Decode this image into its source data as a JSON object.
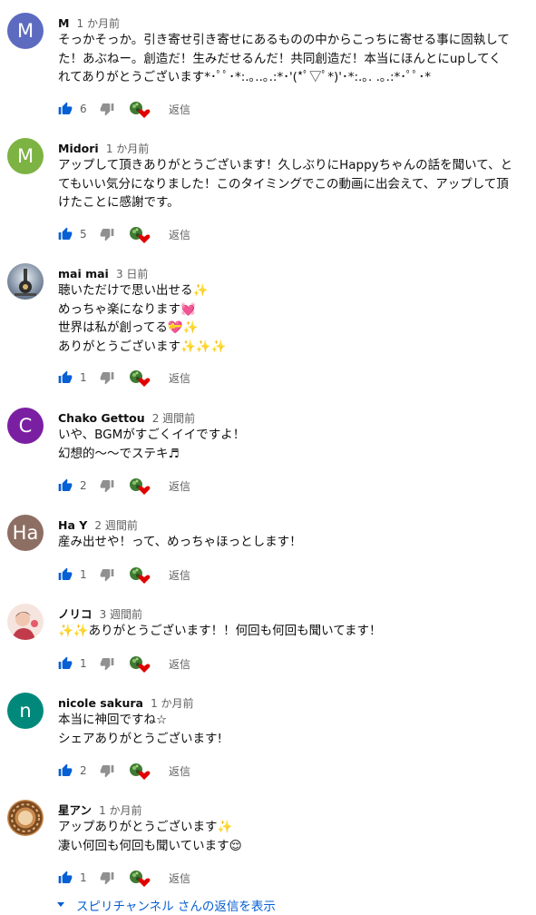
{
  "colors": {
    "link": "#065fd4",
    "like_blue": "#065fd4",
    "muted": "#606060",
    "heart_red": "#e00000"
  },
  "comments": [
    {
      "author": "M",
      "time": "1 か月前",
      "avatar_letter": "M",
      "avatar_color": "#5c6bc0",
      "lines": [
        "そっかそっか。引き寄せ引き寄せにあるものの中からこっちに寄せる事に固執して",
        "た！あぶねー。創造だ！生みだせるんだ！共同創造だ！本当にほんとにupしてく",
        "れてありがとうございます*･ﾟﾟ･*:.｡..｡.:*･'(*ﾟ▽ﾟ*)'･*:.｡. .｡.:*･ﾟﾟ･*"
      ],
      "likes": "6",
      "reply": "返信"
    },
    {
      "author": "Midori",
      "time": "1 か月前",
      "avatar_letter": "M",
      "avatar_color": "#7cb342",
      "lines": [
        "アップして頂きありがとうございます！久しぶりにHappyちゃんの話を聞いて、と",
        "てもいい気分になりました！このタイミングでこの動画に出会えて、アップして頂",
        "けたことに感謝です。"
      ],
      "likes": "5",
      "reply": "返信"
    },
    {
      "author": "mai mai",
      "time": "3 日前",
      "avatar_icon": "telescope-photo",
      "lines": [
        "聴いただけで思い出せる✨",
        "めっちゃ楽になります💓",
        "世界は私が創ってる💝✨",
        "ありがとうございます✨✨✨"
      ],
      "likes": "1",
      "reply": "返信"
    },
    {
      "author": "Chako Gettou",
      "time": "2 週間前",
      "avatar_letter": "C",
      "avatar_color": "#7b1fa2",
      "lines": [
        "いや、BGMがすごくイイですよ！",
        "幻想的〜〜でステキ♬"
      ],
      "likes": "2",
      "reply": "返信"
    },
    {
      "author": "Ha Y",
      "time": "2 週間前",
      "avatar_letter": "Ha",
      "avatar_color": "#8d6e63",
      "lines": [
        "産み出せや！って、めっちゃほっとします！"
      ],
      "likes": "1",
      "reply": "返信"
    },
    {
      "author": "ノリコ",
      "time": "3 週間前",
      "avatar_icon": "person-photo",
      "lines": [
        "✨✨ありがとうございます！！何回も何回も聞いてます！"
      ],
      "likes": "1",
      "reply": "返信"
    },
    {
      "author": "nicole sakura",
      "time": "1 か月前",
      "avatar_letter": "n",
      "avatar_color": "#00897b",
      "lines": [
        "本当に神回ですね☆",
        "シェアありがとうございます!"
      ],
      "likes": "2",
      "reply": "返信"
    },
    {
      "author": "星アン",
      "time": "1 か月前",
      "avatar_icon": "wreath-photo",
      "lines": [
        "アップありがとうございます✨",
        "凄い何回も何回も聞いています😌"
      ],
      "likes": "1",
      "reply": "返信"
    }
  ],
  "show_replies": "スピリチャンネル さんの返信を表示"
}
